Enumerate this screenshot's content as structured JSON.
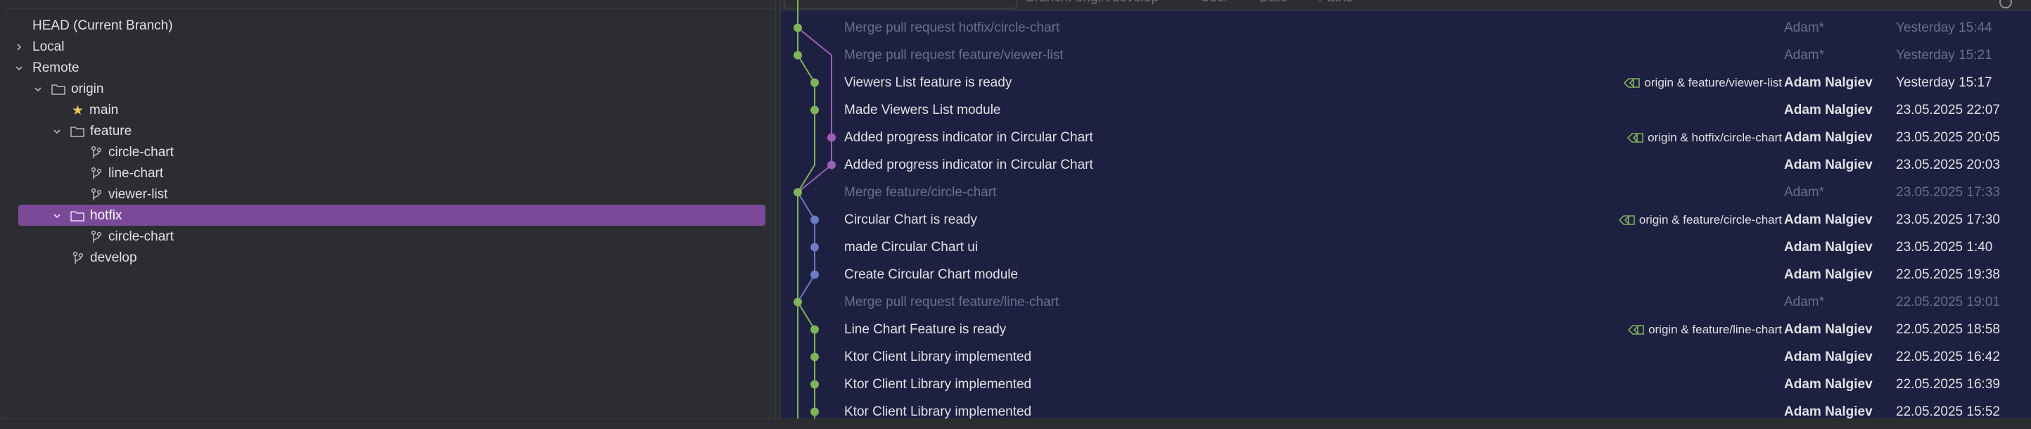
{
  "branches_tree": {
    "head": "HEAD (Current Branch)",
    "local": "Local",
    "remote": "Remote",
    "origin": "origin",
    "main": "main",
    "feature": "feature",
    "feature_branches": [
      "circle-chart",
      "line-chart",
      "viewer-list"
    ],
    "hotfix": "hotfix",
    "hotfix_branches": [
      "circle-chart"
    ],
    "develop": "develop"
  },
  "toolbar": {
    "labels": [
      "Branch: origin/develop",
      "User",
      "Date",
      "Paths"
    ]
  },
  "commits": [
    {
      "message": "Merge pull request hotfix/circle-chart",
      "refs": "",
      "author": "Adam*",
      "date": "Yesterday 15:44",
      "merge": true
    },
    {
      "message": "Merge pull request feature/viewer-list",
      "refs": "",
      "author": "Adam*",
      "date": "Yesterday 15:21",
      "merge": true
    },
    {
      "message": "Viewers List feature is ready",
      "refs": "origin & feature/viewer-list",
      "author": "Adam Nalgiev",
      "date": "Yesterday 15:17",
      "merge": false
    },
    {
      "message": "Made Viewers List module",
      "refs": "",
      "author": "Adam Nalgiev",
      "date": "23.05.2025 22:07",
      "merge": false
    },
    {
      "message": "Added progress indicator in Circular Chart",
      "refs": "origin & hotfix/circle-chart",
      "author": "Adam Nalgiev",
      "date": "23.05.2025 20:05",
      "merge": false
    },
    {
      "message": "Added progress indicator in Circular Chart",
      "refs": "",
      "author": "Adam Nalgiev",
      "date": "23.05.2025 20:03",
      "merge": false
    },
    {
      "message": "Merge feature/circle-chart",
      "refs": "",
      "author": "Adam*",
      "date": "23.05.2025 17:33",
      "merge": true
    },
    {
      "message": "Circular Chart is ready",
      "refs": "origin & feature/circle-chart",
      "author": "Adam Nalgiev",
      "date": "23.05.2025 17:30",
      "merge": false
    },
    {
      "message": "made Circular Chart ui",
      "refs": "",
      "author": "Adam Nalgiev",
      "date": "23.05.2025 1:40",
      "merge": false
    },
    {
      "message": "Create Circular Chart module",
      "refs": "",
      "author": "Adam Nalgiev",
      "date": "22.05.2025 19:38",
      "merge": false
    },
    {
      "message": "Merge pull request feature/line-chart",
      "refs": "",
      "author": "Adam*",
      "date": "22.05.2025 19:01",
      "merge": true
    },
    {
      "message": "Line Chart Feature is ready",
      "refs": "origin & feature/line-chart",
      "author": "Adam Nalgiev",
      "date": "22.05.2025 18:58",
      "merge": false
    },
    {
      "message": "Ktor Client Library implemented",
      "refs": "",
      "author": "Adam Nalgiev",
      "date": "22.05.2025 16:42",
      "merge": false
    },
    {
      "message": "Ktor Client Library implemented",
      "refs": "",
      "author": "Adam Nalgiev",
      "date": "22.05.2025 16:39",
      "merge": false
    },
    {
      "message": "Ktor Client Library implemented",
      "refs": "",
      "author": "Adam Nalgiev",
      "date": "22.05.2025 15:52",
      "merge": false
    }
  ],
  "colors": {
    "lane_main": "#7fb35a",
    "lane_feature": "#6a7cc4",
    "lane_hotfix": "#9b5fb5",
    "selection": "#7a4a99",
    "tag_icon": "#7fb35a"
  }
}
